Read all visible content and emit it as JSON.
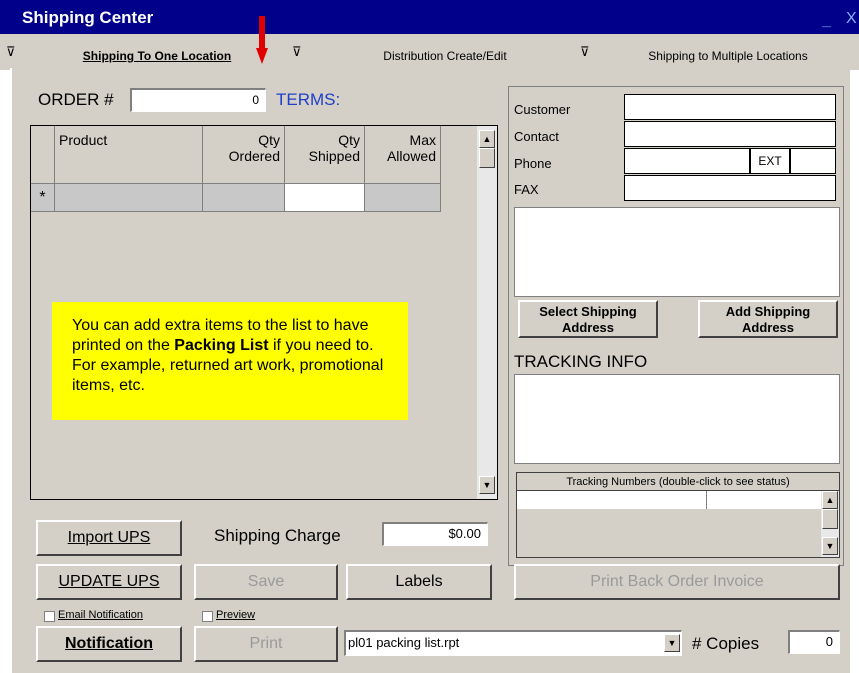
{
  "window": {
    "title": "Shipping Center",
    "minimize": "_",
    "close": "X"
  },
  "tabs": [
    {
      "label": "Shipping To One Location"
    },
    {
      "label": "Distribution Create/Edit"
    },
    {
      "label": "Shipping to Multiple Locations"
    }
  ],
  "order": {
    "label": "ORDER #",
    "value": "0",
    "terms_label": "TERMS:"
  },
  "grid": {
    "columns": [
      "Product",
      "Qty\nOrdered",
      "Qty\nShipped",
      "Max\nAllowed"
    ],
    "new_row_marker": "*"
  },
  "note": {
    "part1": "You can add extra items to the list to have printed on the ",
    "bold": "Packing List",
    "part2": " if you need to.  For example, returned art work, promotional items, etc."
  },
  "customer": {
    "labels": [
      "Customer",
      "Contact",
      "Phone",
      "FAX"
    ],
    "ext_label": "EXT"
  },
  "buttons": {
    "select_shipping": "Select Shipping Address",
    "add_shipping": "Add Shipping Address",
    "import_ups": "Import UPS",
    "update_ups": "UPDATE UPS",
    "save": "Save",
    "labels": "Labels",
    "print_back_order": "Print Back Order Invoice",
    "notification": "Notification",
    "print": "Print"
  },
  "tracking": {
    "title": "TRACKING INFO",
    "numbers_header": "Tracking Numbers (double-click to see status)"
  },
  "shipping_charge": {
    "label": "Shipping Charge",
    "value": "$0.00"
  },
  "checkboxes": {
    "email_notification": "Email Notification",
    "preview": "Preview"
  },
  "report": {
    "value": "pl01 packing list.rpt"
  },
  "copies": {
    "label": "# Copies",
    "value": "0"
  },
  "colors": {
    "title_bar": "#00008b",
    "note_bg": "#ffff00",
    "terms": "#1f3ec8",
    "arrow": "#e00000"
  }
}
